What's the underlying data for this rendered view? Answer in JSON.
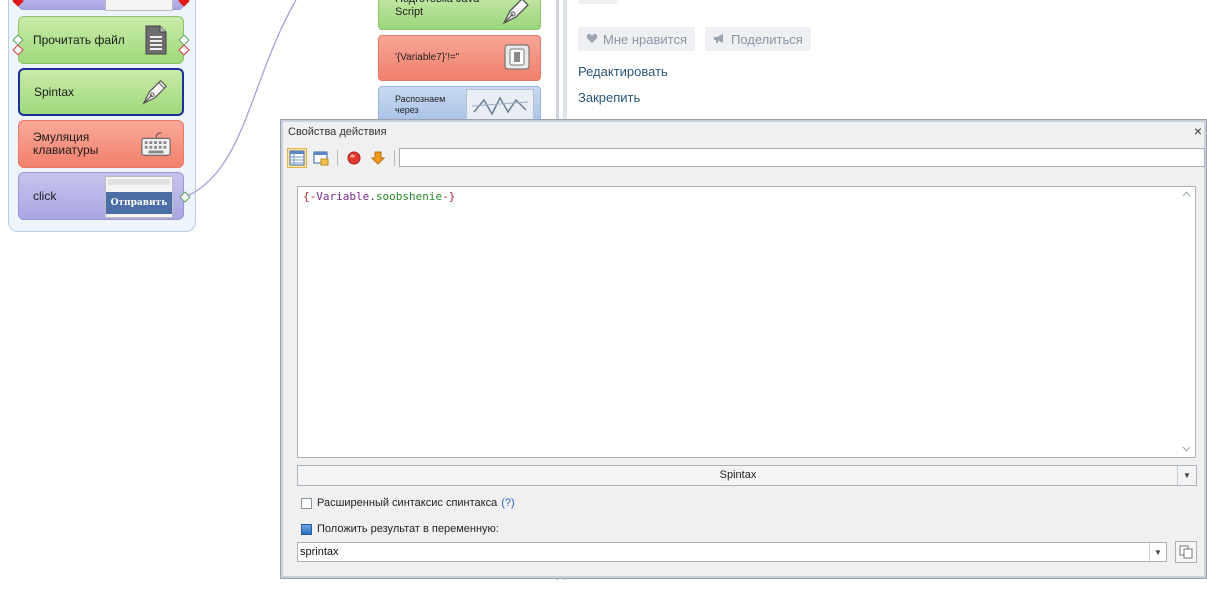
{
  "canvas": {
    "nodes": [
      {
        "label": "Прочитать файл",
        "color": "#a9dd88"
      },
      {
        "label": "Spintax",
        "color": "#a9dd88"
      },
      {
        "label": "Эмуляция клавиатуры",
        "color": "#f38d7a"
      },
      {
        "label": "click",
        "color": "#aeaae5"
      }
    ],
    "button_thumb_label": "Отправить"
  },
  "palette": {
    "items": [
      {
        "label": "Подготовка Java Script"
      },
      {
        "label": "'{Variable7}'!=\""
      },
      {
        "label": "Распознаем через"
      }
    ]
  },
  "web": {
    "like_label": "Мне нравится",
    "share_label": "Поделиться",
    "edit_link": "Редактировать",
    "pin_link": "Закрепить"
  },
  "dialog": {
    "title": "Свойства действия",
    "close_glyph": "×",
    "search_value": "",
    "code": {
      "open": "{-",
      "var": "Variable",
      "dot": ".",
      "name": "soobshenie",
      "close": "-}"
    },
    "combo_value": "Spintax",
    "ext_syntax_label": "Расширенный синтаксис спинтакса",
    "ext_syntax_help": "(?)",
    "ext_syntax_checked": false,
    "put_result_label": "Положить результат в переменную:",
    "put_result_checked": true,
    "variable_value": "sprintax"
  },
  "icons": {
    "table_view": "table-view-icon",
    "window_view": "window-view-icon",
    "stop": "stop-icon",
    "arrow_down": "arrow-down-icon",
    "file": "file-icon",
    "pen": "pen-icon",
    "keyboard": "keyboard-icon",
    "switch": "switch-icon",
    "captcha": "captcha-icon",
    "heart": "heart-icon",
    "megaphone": "megaphone-icon",
    "copy": "copy-icon"
  },
  "colors": {
    "accent_link": "#2b587a",
    "help_link": "#2b64c5",
    "dialog_bg": "#f0f0f0"
  }
}
